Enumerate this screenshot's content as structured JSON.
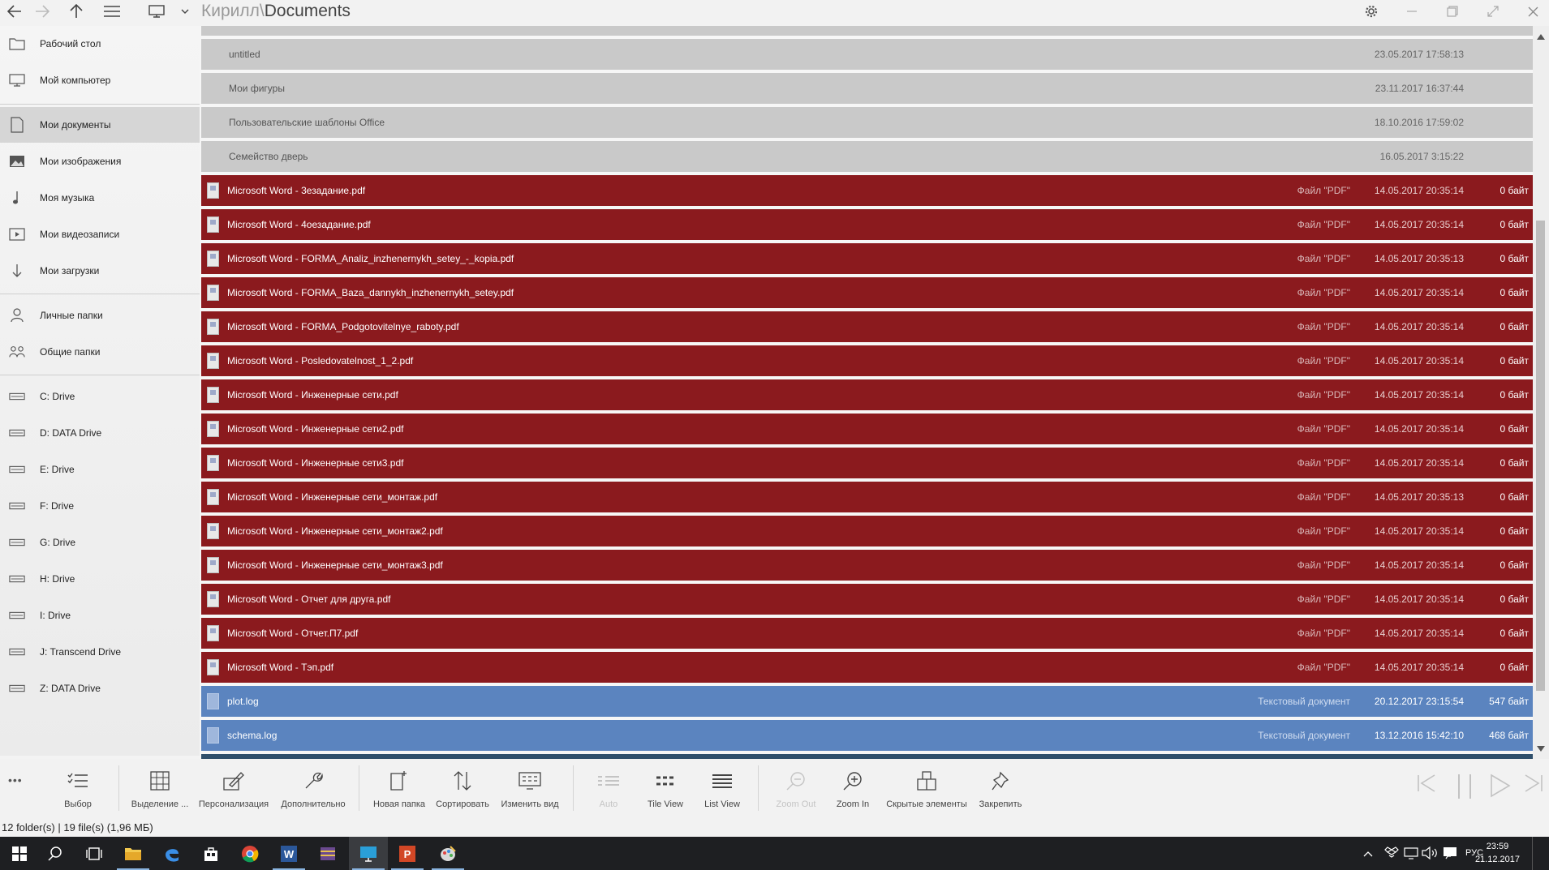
{
  "titlebar": {
    "path_prefix": "Кирилл\\",
    "path_current": "Documents"
  },
  "sidebar": {
    "items": [
      {
        "label": "Рабочий стол",
        "icon": "folder-icon"
      },
      {
        "label": "Мой компьютер",
        "icon": "monitor-icon"
      },
      {
        "label": "Мои документы",
        "icon": "document-icon",
        "active": true
      },
      {
        "label": "Мои изображения",
        "icon": "image-icon"
      },
      {
        "label": "Моя музыка",
        "icon": "music-icon"
      },
      {
        "label": "Мои видеозаписи",
        "icon": "video-icon"
      },
      {
        "label": "Мои загрузки",
        "icon": "download-icon"
      },
      {
        "label": "Личные папки",
        "icon": "person-icon"
      },
      {
        "label": "Общие папки",
        "icon": "people-icon"
      },
      {
        "label": "C:  Drive",
        "icon": "drive-icon"
      },
      {
        "label": "D: DATA Drive",
        "icon": "drive-icon"
      },
      {
        "label": "E:  Drive",
        "icon": "drive-icon"
      },
      {
        "label": "F:  Drive",
        "icon": "drive-icon"
      },
      {
        "label": "G:  Drive",
        "icon": "drive-icon"
      },
      {
        "label": "H:  Drive",
        "icon": "drive-icon"
      },
      {
        "label": "I:  Drive",
        "icon": "drive-icon"
      },
      {
        "label": "J: Transcend Drive",
        "icon": "drive-icon"
      },
      {
        "label": "Z: DATA Drive",
        "icon": "drive-icon"
      }
    ]
  },
  "files": {
    "folders": [
      {
        "name": "untitled",
        "date": "23.05.2017 17:58:13"
      },
      {
        "name": "Мои фигуры",
        "date": "23.11.2017 16:37:44"
      },
      {
        "name": "Пользовательские шаблоны Office",
        "date": "18.10.2016 17:59:02"
      },
      {
        "name": "Семейство дверь",
        "date": "16.05.2017 3:15:22"
      }
    ],
    "pdfs": [
      {
        "name": "Microsoft Word - 3езадание.pdf",
        "type": "Файл \"PDF\"",
        "date": "14.05.2017 20:35:14",
        "size": "0 байт"
      },
      {
        "name": "Microsoft Word - 4оезадание.pdf",
        "type": "Файл \"PDF\"",
        "date": "14.05.2017 20:35:14",
        "size": "0 байт"
      },
      {
        "name": "Microsoft Word - FORMA_Analiz_inzhenernykh_setey_-_kopia.pdf",
        "type": "Файл \"PDF\"",
        "date": "14.05.2017 20:35:13",
        "size": "0 байт"
      },
      {
        "name": "Microsoft Word - FORMA_Baza_dannykh_inzhenernykh_setey.pdf",
        "type": "Файл \"PDF\"",
        "date": "14.05.2017 20:35:14",
        "size": "0 байт"
      },
      {
        "name": "Microsoft Word - FORMA_Podgotovitelnye_raboty.pdf",
        "type": "Файл \"PDF\"",
        "date": "14.05.2017 20:35:14",
        "size": "0 байт"
      },
      {
        "name": "Microsoft Word - Posledovatelnost_1_2.pdf",
        "type": "Файл \"PDF\"",
        "date": "14.05.2017 20:35:14",
        "size": "0 байт"
      },
      {
        "name": "Microsoft Word - Инженерные сети.pdf",
        "type": "Файл \"PDF\"",
        "date": "14.05.2017 20:35:14",
        "size": "0 байт"
      },
      {
        "name": "Microsoft Word - Инженерные сети2.pdf",
        "type": "Файл \"PDF\"",
        "date": "14.05.2017 20:35:14",
        "size": "0 байт"
      },
      {
        "name": "Microsoft Word - Инженерные сети3.pdf",
        "type": "Файл \"PDF\"",
        "date": "14.05.2017 20:35:14",
        "size": "0 байт"
      },
      {
        "name": "Microsoft Word - Инженерные сети_монтаж.pdf",
        "type": "Файл \"PDF\"",
        "date": "14.05.2017 20:35:13",
        "size": "0 байт"
      },
      {
        "name": "Microsoft Word - Инженерные сети_монтаж2.pdf",
        "type": "Файл \"PDF\"",
        "date": "14.05.2017 20:35:14",
        "size": "0 байт"
      },
      {
        "name": "Microsoft Word - Инженерные сети_монтаж3.pdf",
        "type": "Файл \"PDF\"",
        "date": "14.05.2017 20:35:14",
        "size": "0 байт"
      },
      {
        "name": "Microsoft Word - Отчет для друга.pdf",
        "type": "Файл \"PDF\"",
        "date": "14.05.2017 20:35:14",
        "size": "0 байт"
      },
      {
        "name": "Microsoft Word - Отчет.П7.pdf",
        "type": "Файл \"PDF\"",
        "date": "14.05.2017 20:35:14",
        "size": "0 байт"
      },
      {
        "name": "Microsoft Word - Тэп.pdf",
        "type": "Файл \"PDF\"",
        "date": "14.05.2017 20:35:14",
        "size": "0 байт"
      }
    ],
    "logs": [
      {
        "name": "plot.log",
        "type": "Текстовый документ",
        "date": "20.12.2017 23:15:54",
        "size": "547 байт"
      },
      {
        "name": "schema.log",
        "type": "Текстовый документ",
        "date": "13.12.2016 15:42:10",
        "size": "468 байт"
      }
    ]
  },
  "commands": {
    "more": "•••",
    "select": "Выбор",
    "selection": "Выделение ...",
    "personalize": "Персонализация",
    "more_options": "Дополнительно",
    "new_folder": "Новая папка",
    "sort": "Сортировать",
    "change_view": "Изменить вид",
    "auto": "Auto",
    "tile_view": "Tile View",
    "list_view": "List View",
    "zoom_out": "Zoom Out",
    "zoom_in": "Zoom In",
    "hidden_items": "Скрытые элементы",
    "pin": "Закрепить"
  },
  "status": {
    "text": "12 folder(s)  |  19 file(s) (1,96 МБ)"
  },
  "taskbar": {
    "lang": "РУС",
    "time": "23:59",
    "date": "21.12.2017"
  },
  "colors": {
    "pdf_row": "#8b1a1e",
    "log_row": "#5b84bf",
    "folder_row": "#c9c9c9"
  }
}
